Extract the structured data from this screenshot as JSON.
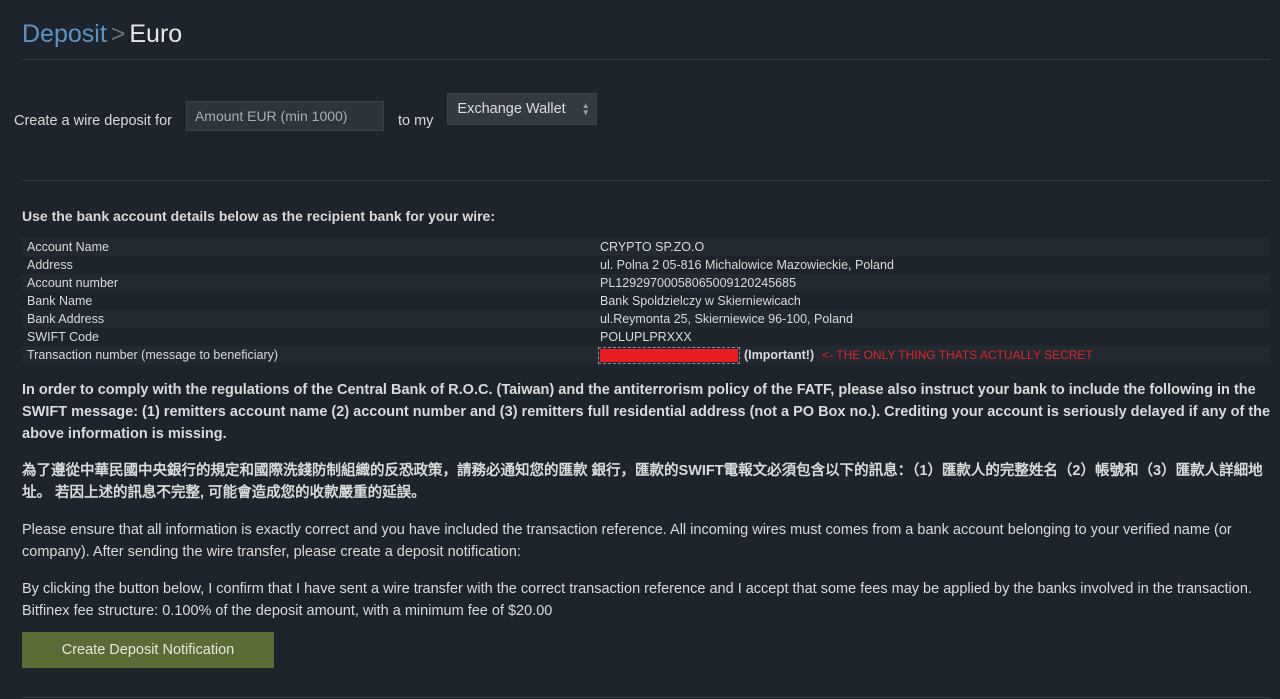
{
  "header": {
    "crumb": "Deposit",
    "separator": ">",
    "current": "Euro"
  },
  "form": {
    "prefix": "Create a wire deposit for",
    "amount_placeholder": "Amount EUR (min 1000)",
    "amount_value": "",
    "middle": "to my",
    "wallet_selected": "Exchange Wallet"
  },
  "bank": {
    "lead": "Use the bank account details below as the recipient bank for your wire:",
    "rows": [
      {
        "label": "Account Name",
        "value": "CRYPTO SP.ZO.O"
      },
      {
        "label": "Address",
        "value": "ul. Polna 2 05-816 Michalowice Mazowieckie, Poland"
      },
      {
        "label": "Account number",
        "value": "PL12929700058065009120245685"
      },
      {
        "label": "Bank Name",
        "value": "Bank Spoldzielczy w Skierniewicach"
      },
      {
        "label": "Bank Address",
        "value": "ul.Reymonta 25, Skierniewice 96-100, Poland"
      },
      {
        "label": "SWIFT Code",
        "value": "POLUPLPRXXX"
      }
    ],
    "transaction_label": "Transaction number (message to beneficiary)",
    "important": "(Important!)",
    "annotation": "<- THE ONLY THING THATS ACTUALLY SECRET",
    "annotation_color": "#e0242c"
  },
  "paragraphs": {
    "regulation_en": "In order to comply with the regulations of the Central Bank of R.O.C. (Taiwan) and the antiterrorism policy of the FATF, please also instruct your bank to include the following in the SWIFT message: (1) remitters account name (2) account number and (3) remitters full residential address (not a PO Box no.). Crediting your account is seriously delayed if any of the above information is missing.",
    "regulation_zh": "為了遵從中華民國中央銀行的規定和國際洗錢防制組織的反恐政策，請務必通知您的匯款 銀行，匯款的SWIFT電報文必須包含以下的訊息：（1）匯款人的完整姓名（2）帳號和（3）匯款人詳細地址。 若因上述的訊息不完整, 可能會造成您的收款嚴重的延誤。",
    "ensure": "Please ensure that all information is exactly correct and you have included the transaction reference. All incoming wires must comes from a bank account belonging to your verified name (or company). After sending the wire transfer, please create a deposit notification:",
    "confirm": "By clicking the button below, I confirm that I have sent a wire transfer with the correct transaction reference and I accept that some fees may be applied by the banks involved in the transaction. Bitfinex fee structure: 0.100% of the deposit amount, with a minimum fee of $20.00"
  },
  "button": {
    "label": "Create Deposit Notification",
    "color": "#5a6b34"
  }
}
